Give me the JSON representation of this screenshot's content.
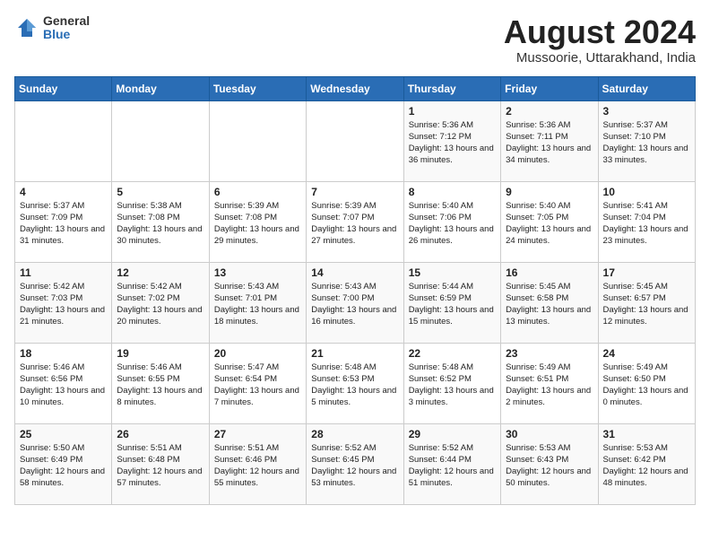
{
  "logo": {
    "general": "General",
    "blue": "Blue"
  },
  "title": {
    "month_year": "August 2024",
    "location": "Mussoorie, Uttarakhand, India"
  },
  "headers": [
    "Sunday",
    "Monday",
    "Tuesday",
    "Wednesday",
    "Thursday",
    "Friday",
    "Saturday"
  ],
  "weeks": [
    [
      {
        "day": "",
        "info": ""
      },
      {
        "day": "",
        "info": ""
      },
      {
        "day": "",
        "info": ""
      },
      {
        "day": "",
        "info": ""
      },
      {
        "day": "1",
        "sunrise": "Sunrise: 5:36 AM",
        "sunset": "Sunset: 7:12 PM",
        "daylight": "Daylight: 13 hours and 36 minutes."
      },
      {
        "day": "2",
        "sunrise": "Sunrise: 5:36 AM",
        "sunset": "Sunset: 7:11 PM",
        "daylight": "Daylight: 13 hours and 34 minutes."
      },
      {
        "day": "3",
        "sunrise": "Sunrise: 5:37 AM",
        "sunset": "Sunset: 7:10 PM",
        "daylight": "Daylight: 13 hours and 33 minutes."
      }
    ],
    [
      {
        "day": "4",
        "sunrise": "Sunrise: 5:37 AM",
        "sunset": "Sunset: 7:09 PM",
        "daylight": "Daylight: 13 hours and 31 minutes."
      },
      {
        "day": "5",
        "sunrise": "Sunrise: 5:38 AM",
        "sunset": "Sunset: 7:08 PM",
        "daylight": "Daylight: 13 hours and 30 minutes."
      },
      {
        "day": "6",
        "sunrise": "Sunrise: 5:39 AM",
        "sunset": "Sunset: 7:08 PM",
        "daylight": "Daylight: 13 hours and 29 minutes."
      },
      {
        "day": "7",
        "sunrise": "Sunrise: 5:39 AM",
        "sunset": "Sunset: 7:07 PM",
        "daylight": "Daylight: 13 hours and 27 minutes."
      },
      {
        "day": "8",
        "sunrise": "Sunrise: 5:40 AM",
        "sunset": "Sunset: 7:06 PM",
        "daylight": "Daylight: 13 hours and 26 minutes."
      },
      {
        "day": "9",
        "sunrise": "Sunrise: 5:40 AM",
        "sunset": "Sunset: 7:05 PM",
        "daylight": "Daylight: 13 hours and 24 minutes."
      },
      {
        "day": "10",
        "sunrise": "Sunrise: 5:41 AM",
        "sunset": "Sunset: 7:04 PM",
        "daylight": "Daylight: 13 hours and 23 minutes."
      }
    ],
    [
      {
        "day": "11",
        "sunrise": "Sunrise: 5:42 AM",
        "sunset": "Sunset: 7:03 PM",
        "daylight": "Daylight: 13 hours and 21 minutes."
      },
      {
        "day": "12",
        "sunrise": "Sunrise: 5:42 AM",
        "sunset": "Sunset: 7:02 PM",
        "daylight": "Daylight: 13 hours and 20 minutes."
      },
      {
        "day": "13",
        "sunrise": "Sunrise: 5:43 AM",
        "sunset": "Sunset: 7:01 PM",
        "daylight": "Daylight: 13 hours and 18 minutes."
      },
      {
        "day": "14",
        "sunrise": "Sunrise: 5:43 AM",
        "sunset": "Sunset: 7:00 PM",
        "daylight": "Daylight: 13 hours and 16 minutes."
      },
      {
        "day": "15",
        "sunrise": "Sunrise: 5:44 AM",
        "sunset": "Sunset: 6:59 PM",
        "daylight": "Daylight: 13 hours and 15 minutes."
      },
      {
        "day": "16",
        "sunrise": "Sunrise: 5:45 AM",
        "sunset": "Sunset: 6:58 PM",
        "daylight": "Daylight: 13 hours and 13 minutes."
      },
      {
        "day": "17",
        "sunrise": "Sunrise: 5:45 AM",
        "sunset": "Sunset: 6:57 PM",
        "daylight": "Daylight: 13 hours and 12 minutes."
      }
    ],
    [
      {
        "day": "18",
        "sunrise": "Sunrise: 5:46 AM",
        "sunset": "Sunset: 6:56 PM",
        "daylight": "Daylight: 13 hours and 10 minutes."
      },
      {
        "day": "19",
        "sunrise": "Sunrise: 5:46 AM",
        "sunset": "Sunset: 6:55 PM",
        "daylight": "Daylight: 13 hours and 8 minutes."
      },
      {
        "day": "20",
        "sunrise": "Sunrise: 5:47 AM",
        "sunset": "Sunset: 6:54 PM",
        "daylight": "Daylight: 13 hours and 7 minutes."
      },
      {
        "day": "21",
        "sunrise": "Sunrise: 5:48 AM",
        "sunset": "Sunset: 6:53 PM",
        "daylight": "Daylight: 13 hours and 5 minutes."
      },
      {
        "day": "22",
        "sunrise": "Sunrise: 5:48 AM",
        "sunset": "Sunset: 6:52 PM",
        "daylight": "Daylight: 13 hours and 3 minutes."
      },
      {
        "day": "23",
        "sunrise": "Sunrise: 5:49 AM",
        "sunset": "Sunset: 6:51 PM",
        "daylight": "Daylight: 13 hours and 2 minutes."
      },
      {
        "day": "24",
        "sunrise": "Sunrise: 5:49 AM",
        "sunset": "Sunset: 6:50 PM",
        "daylight": "Daylight: 13 hours and 0 minutes."
      }
    ],
    [
      {
        "day": "25",
        "sunrise": "Sunrise: 5:50 AM",
        "sunset": "Sunset: 6:49 PM",
        "daylight": "Daylight: 12 hours and 58 minutes."
      },
      {
        "day": "26",
        "sunrise": "Sunrise: 5:51 AM",
        "sunset": "Sunset: 6:48 PM",
        "daylight": "Daylight: 12 hours and 57 minutes."
      },
      {
        "day": "27",
        "sunrise": "Sunrise: 5:51 AM",
        "sunset": "Sunset: 6:46 PM",
        "daylight": "Daylight: 12 hours and 55 minutes."
      },
      {
        "day": "28",
        "sunrise": "Sunrise: 5:52 AM",
        "sunset": "Sunset: 6:45 PM",
        "daylight": "Daylight: 12 hours and 53 minutes."
      },
      {
        "day": "29",
        "sunrise": "Sunrise: 5:52 AM",
        "sunset": "Sunset: 6:44 PM",
        "daylight": "Daylight: 12 hours and 51 minutes."
      },
      {
        "day": "30",
        "sunrise": "Sunrise: 5:53 AM",
        "sunset": "Sunset: 6:43 PM",
        "daylight": "Daylight: 12 hours and 50 minutes."
      },
      {
        "day": "31",
        "sunrise": "Sunrise: 5:53 AM",
        "sunset": "Sunset: 6:42 PM",
        "daylight": "Daylight: 12 hours and 48 minutes."
      }
    ]
  ]
}
